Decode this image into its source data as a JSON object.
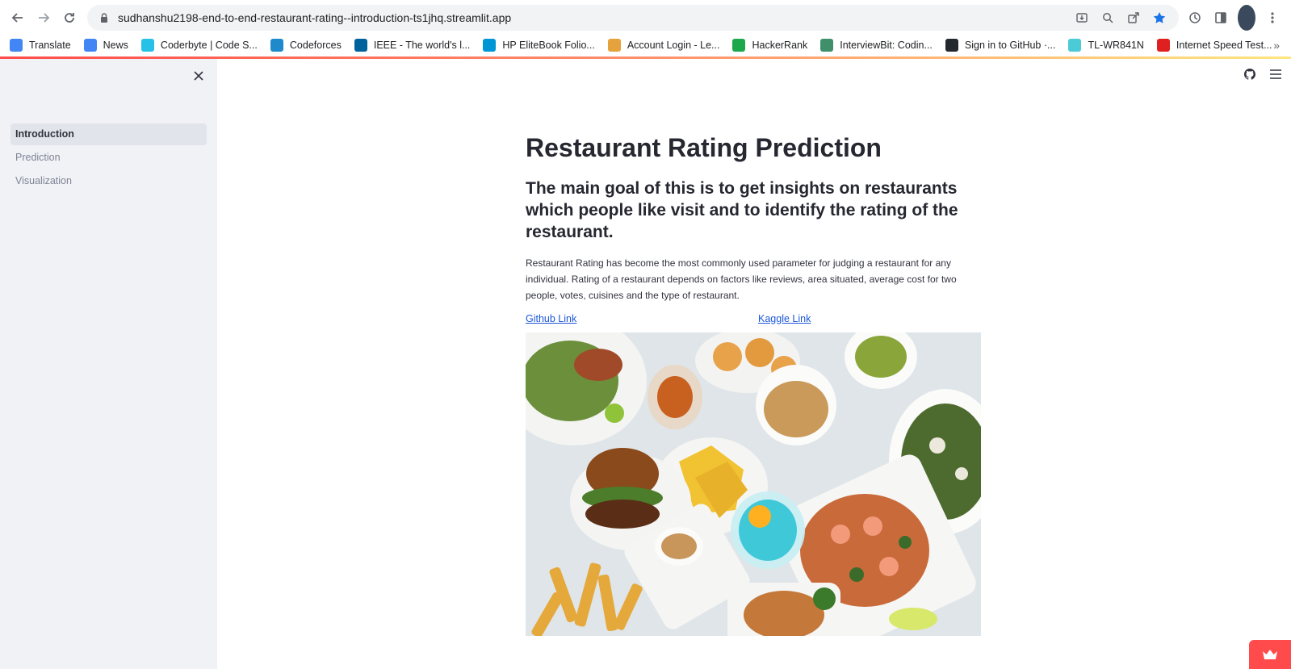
{
  "browser": {
    "url": "sudhanshu2198-end-to-end-restaurant-rating--introduction-ts1jhq.streamlit.app",
    "bookmarks": [
      {
        "label": "Translate",
        "color": "#4285f4"
      },
      {
        "label": "News",
        "color": "#4285f4"
      },
      {
        "label": "Coderbyte | Code S...",
        "color": "#27c1e8"
      },
      {
        "label": "Codeforces",
        "color": "#1f8acb"
      },
      {
        "label": "IEEE - The world's l...",
        "color": "#00629b"
      },
      {
        "label": "HP EliteBook Folio...",
        "color": "#0096d6"
      },
      {
        "label": "Account Login - Le...",
        "color": "#e6a23c"
      },
      {
        "label": "HackerRank",
        "color": "#1ba94c"
      },
      {
        "label": "InterviewBit: Codin...",
        "color": "#3f8f6b"
      },
      {
        "label": "Sign in to GitHub ·...",
        "color": "#24292f"
      },
      {
        "label": "TL-WR841N",
        "color": "#4acbd6"
      },
      {
        "label": "Internet Speed Test...",
        "color": "#e02020"
      }
    ]
  },
  "sidebar": {
    "items": [
      {
        "label": "Introduction",
        "active": true
      },
      {
        "label": "Prediction",
        "active": false
      },
      {
        "label": "Visualization",
        "active": false
      }
    ]
  },
  "main": {
    "title": "Restaurant Rating Prediction",
    "subtitle": "The main goal of this is to get insights on restaurants which people like visit and to identify the rating of the restaurant.",
    "description": "Restaurant Rating has become the most commonly used parameter for judging a restaurant for any individual. Rating of a restaurant depends on factors like reviews, area situated, average cost for two people, votes, cuisines and the type of restaurant.",
    "github_link": "Github Link",
    "kaggle_link": "Kaggle Link"
  },
  "colors": {
    "accent": "#ff4b4b",
    "sidebar_bg": "#f0f2f6",
    "link": "#1a56db"
  }
}
